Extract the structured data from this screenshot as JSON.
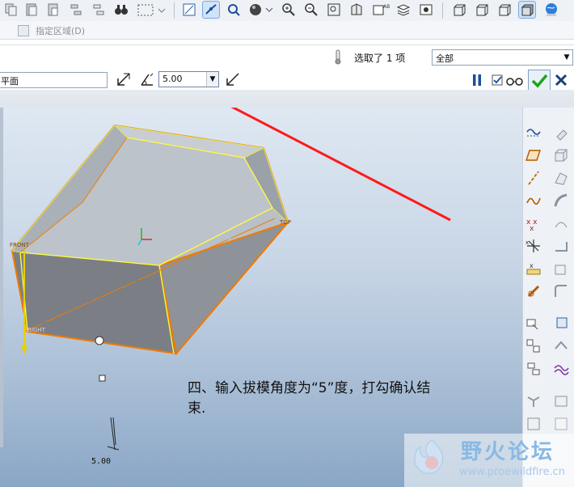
{
  "filter_bar": {
    "area_label": "指定区域(D)"
  },
  "dashboard": {
    "reference_field_value": "平面",
    "draft_angle": "5.00",
    "selection_status": "选取了 1 项",
    "filter_value": "全部"
  },
  "model_labels": {
    "front": "FRONT",
    "top": "TOP",
    "right": "RIGHT",
    "dim_value": "5.00"
  },
  "instruction": {
    "line1": "四、输入拔模角度为“5”度，打勾确认结",
    "line2": "束."
  },
  "watermark": {
    "title": "野火论坛",
    "url": "www.proewildfire.cn"
  },
  "colors": {
    "model_edge": "#f07a00",
    "selection_yellow": "#ffff40",
    "arrow_red": "#ff1a1a",
    "ok_green": "#1fa31f"
  }
}
